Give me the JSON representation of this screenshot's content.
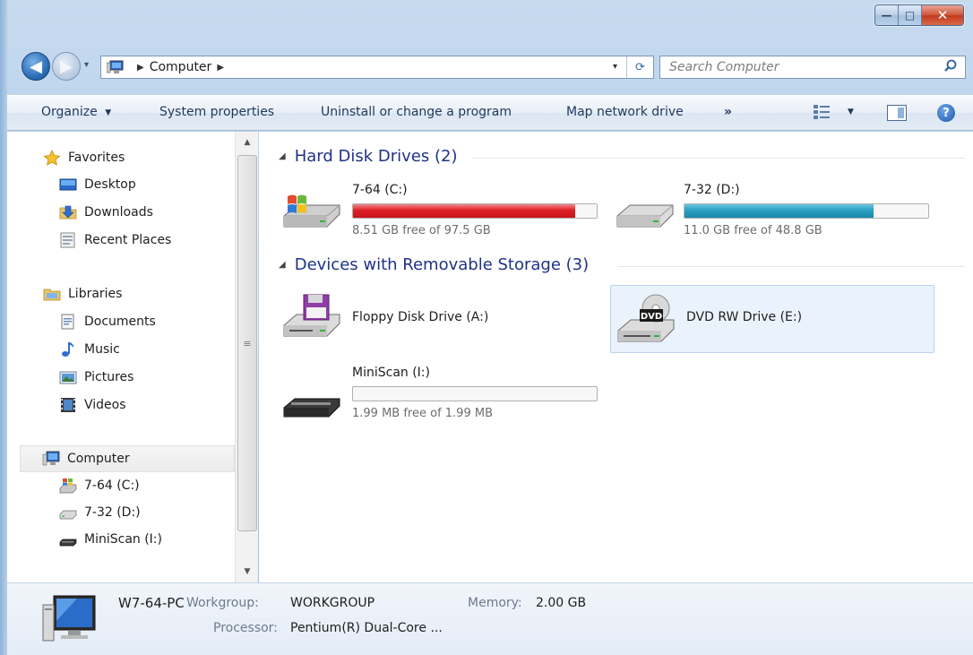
{
  "window": {
    "minimize_glyph": "—",
    "maximize_glyph": "□",
    "close_glyph": "✕"
  },
  "address": {
    "back_glyph": "◀",
    "forward_glyph": "▶",
    "segments": [
      "Computer"
    ],
    "separator": "▶",
    "dropdown_glyph": "▾",
    "refresh_glyph": "⟳"
  },
  "search": {
    "placeholder": "Search Computer",
    "icon": "search-icon"
  },
  "toolbar": {
    "organize": "Organize",
    "organize_arrow": "▼",
    "system_properties": "System properties",
    "uninstall": "Uninstall or change a program",
    "map_drive": "Map network drive",
    "overflow": "»",
    "view_arrow": "▼",
    "help": "?"
  },
  "nav": {
    "favorites": {
      "label": "Favorites",
      "items": [
        "Desktop",
        "Downloads",
        "Recent Places"
      ]
    },
    "libraries": {
      "label": "Libraries",
      "items": [
        "Documents",
        "Music",
        "Pictures",
        "Videos"
      ]
    },
    "computer": {
      "label": "Computer",
      "items": [
        "7-64 (C:)",
        "7-32 (D:)",
        "MiniScan (I:)"
      ]
    },
    "scroll_up": "▲",
    "scroll_down": "▼",
    "scroll_grip": "≡"
  },
  "groups": {
    "hdd": {
      "collapse_glyph": "◢",
      "title": "Hard Disk Drives (2)"
    },
    "removable": {
      "collapse_glyph": "◢",
      "title": "Devices with Removable Storage (3)"
    }
  },
  "drives": {
    "c": {
      "name": "7-64 (C:)",
      "free": "8.51 GB free of 97.5 GB",
      "used_fraction": 0.913
    },
    "d": {
      "name": "7-32 (D:)",
      "free": "11.0 GB free of 48.8 GB",
      "used_fraction": 0.775
    },
    "a": {
      "name": "Floppy Disk Drive (A:)"
    },
    "e": {
      "name": "DVD RW Drive (E:)",
      "badge": "DVD"
    },
    "i": {
      "name": "MiniScan (I:)",
      "free": "1.99 MB free of 1.99 MB",
      "used_fraction": 0.0
    }
  },
  "details": {
    "pc_name": "W7-64-PC",
    "workgroup_label": "Workgroup:",
    "workgroup": "WORKGROUP",
    "memory_label": "Memory:",
    "memory": "2.00 GB",
    "processor_label": "Processor:",
    "processor": "Pentium(R) Dual-Core ..."
  },
  "colors": {
    "accent": "#1e3287",
    "bar_full": "#dc1e24",
    "bar_normal": "#2aa0c2"
  }
}
